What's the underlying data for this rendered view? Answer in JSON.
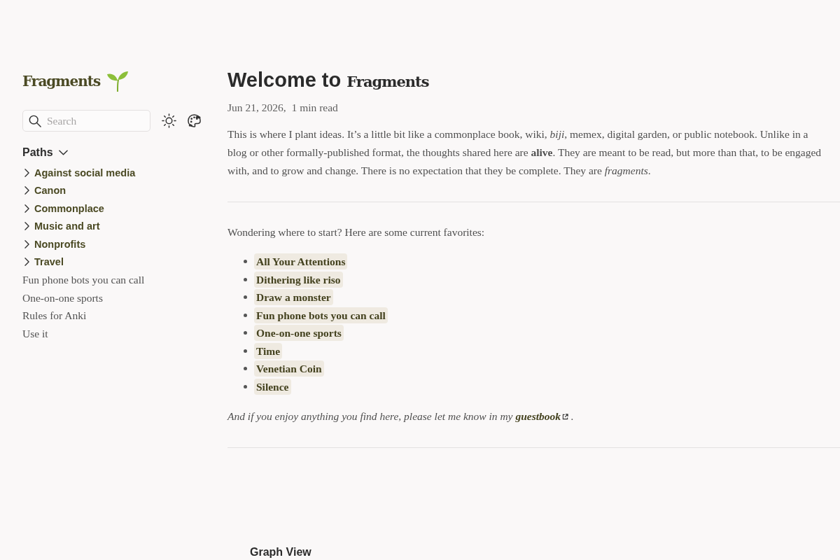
{
  "sidebar": {
    "logo": "Fragments",
    "search": {
      "placeholder": "Search"
    },
    "explorer": {
      "title": "Paths",
      "expanded": true,
      "items": [
        {
          "kind": "folder",
          "label": "Against social media",
          "expanded": false
        },
        {
          "kind": "folder",
          "label": "Canon",
          "expanded": false
        },
        {
          "kind": "folder",
          "label": "Commonplace",
          "expanded": false
        },
        {
          "kind": "folder",
          "label": "Music and art",
          "expanded": false
        },
        {
          "kind": "folder",
          "label": "Nonprofits",
          "expanded": false
        },
        {
          "kind": "folder",
          "label": "Travel",
          "expanded": false
        },
        {
          "kind": "page",
          "label": "Fun phone bots you can call"
        },
        {
          "kind": "page",
          "label": "One-on-one sports"
        },
        {
          "kind": "page",
          "label": "Rules for Anki"
        },
        {
          "kind": "page",
          "label": "Use it"
        }
      ]
    }
  },
  "article": {
    "title": "Welcome to",
    "title_brand": "Fragments",
    "date": "Jun 21, 2026,",
    "reading_time": "1 min read",
    "intro": "This is where I plant ideas. It’s a little bit like a commonplace book, wiki, *biji*, memex, digital garden, or public notebook. Unlike in a blog or other formally-published format, the thoughts shared here are **alive**. They are meant to be read, but more than that, to be engaged with, and to grow and change. There is no expectation that they be complete. They are *fragments*.",
    "prompt": "Wondering where to start? Here are some current favorites:",
    "favorites": [
      "All Your Attentions",
      "Dithering like riso",
      "Draw a monster",
      "Fun phone bots you can call",
      "One-on-one sports",
      "Time",
      "Venetian Coin",
      "Silence"
    ],
    "closing": {
      "text": "And if you enjoy anything you find here, please let me know in my",
      "link": "guestbook",
      "end": "."
    }
  },
  "graph": {
    "title": "Graph View"
  }
}
